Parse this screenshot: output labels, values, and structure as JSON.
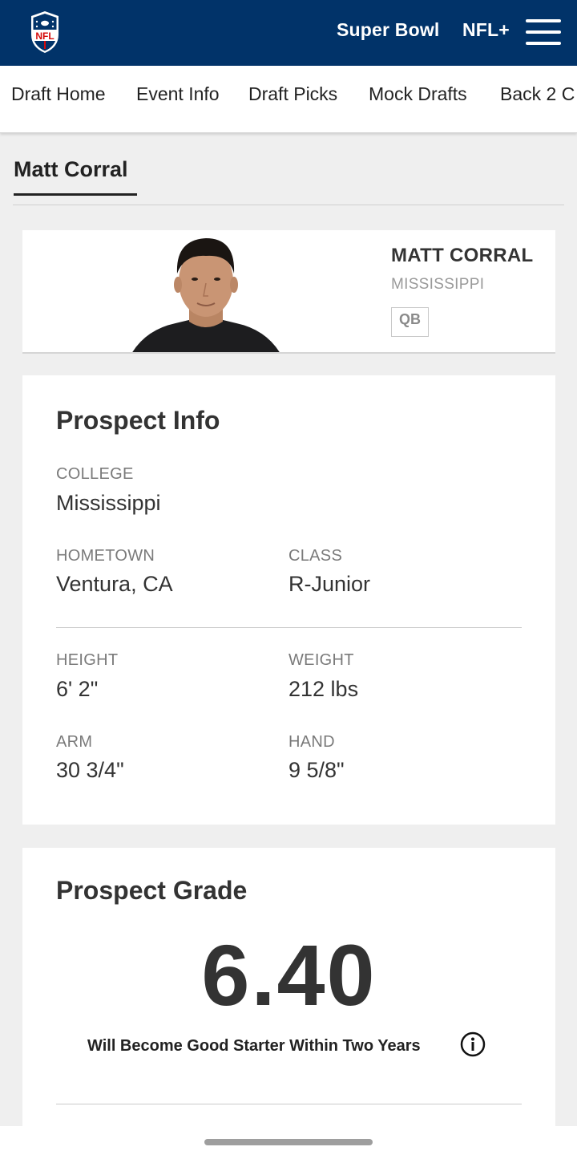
{
  "header": {
    "links": [
      "Super Bowl",
      "NFL+"
    ]
  },
  "subnav": {
    "items": [
      "Draft Home",
      "Event Info",
      "Draft Picks",
      "Mock Drafts",
      "Back 2 C"
    ]
  },
  "tab": {
    "label": "Matt Corral"
  },
  "hero": {
    "name": "MATT CORRAL",
    "college": "MISSISSIPPI",
    "position": "QB"
  },
  "prospect_info": {
    "title": "Prospect Info",
    "college": {
      "label": "COLLEGE",
      "value": "Mississippi"
    },
    "hometown": {
      "label": "HOMETOWN",
      "value": "Ventura, CA"
    },
    "class": {
      "label": "CLASS",
      "value": "R-Junior"
    },
    "height": {
      "label": "HEIGHT",
      "value": "6' 2\""
    },
    "weight": {
      "label": "WEIGHT",
      "value": "212 lbs"
    },
    "arm": {
      "label": "ARM",
      "value": "30 3/4\""
    },
    "hand": {
      "label": "HAND",
      "value": "9 5/8\""
    }
  },
  "prospect_grade": {
    "title": "Prospect Grade",
    "value": "6.40",
    "description": "Will Become Good Starter Within Two Years"
  },
  "colors": {
    "header_bg": "#013369",
    "page_bg": "#efefef",
    "nfl_red": "#d50a0a"
  },
  "icons": [
    "nfl-shield-logo",
    "hamburger-menu-icon",
    "info-icon"
  ]
}
